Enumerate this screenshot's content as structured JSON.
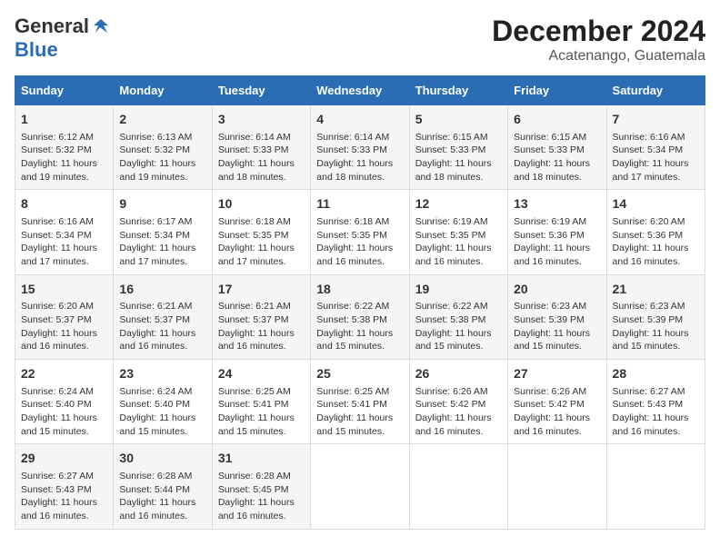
{
  "logo": {
    "general": "General",
    "blue": "Blue"
  },
  "title": "December 2024",
  "subtitle": "Acatenango, Guatemala",
  "headers": [
    "Sunday",
    "Monday",
    "Tuesday",
    "Wednesday",
    "Thursday",
    "Friday",
    "Saturday"
  ],
  "weeks": [
    [
      {
        "day": "1",
        "info": "Sunrise: 6:12 AM\nSunset: 5:32 PM\nDaylight: 11 hours\nand 19 minutes."
      },
      {
        "day": "2",
        "info": "Sunrise: 6:13 AM\nSunset: 5:32 PM\nDaylight: 11 hours\nand 19 minutes."
      },
      {
        "day": "3",
        "info": "Sunrise: 6:14 AM\nSunset: 5:33 PM\nDaylight: 11 hours\nand 18 minutes."
      },
      {
        "day": "4",
        "info": "Sunrise: 6:14 AM\nSunset: 5:33 PM\nDaylight: 11 hours\nand 18 minutes."
      },
      {
        "day": "5",
        "info": "Sunrise: 6:15 AM\nSunset: 5:33 PM\nDaylight: 11 hours\nand 18 minutes."
      },
      {
        "day": "6",
        "info": "Sunrise: 6:15 AM\nSunset: 5:33 PM\nDaylight: 11 hours\nand 18 minutes."
      },
      {
        "day": "7",
        "info": "Sunrise: 6:16 AM\nSunset: 5:34 PM\nDaylight: 11 hours\nand 17 minutes."
      }
    ],
    [
      {
        "day": "8",
        "info": "Sunrise: 6:16 AM\nSunset: 5:34 PM\nDaylight: 11 hours\nand 17 minutes."
      },
      {
        "day": "9",
        "info": "Sunrise: 6:17 AM\nSunset: 5:34 PM\nDaylight: 11 hours\nand 17 minutes."
      },
      {
        "day": "10",
        "info": "Sunrise: 6:18 AM\nSunset: 5:35 PM\nDaylight: 11 hours\nand 17 minutes."
      },
      {
        "day": "11",
        "info": "Sunrise: 6:18 AM\nSunset: 5:35 PM\nDaylight: 11 hours\nand 16 minutes."
      },
      {
        "day": "12",
        "info": "Sunrise: 6:19 AM\nSunset: 5:35 PM\nDaylight: 11 hours\nand 16 minutes."
      },
      {
        "day": "13",
        "info": "Sunrise: 6:19 AM\nSunset: 5:36 PM\nDaylight: 11 hours\nand 16 minutes."
      },
      {
        "day": "14",
        "info": "Sunrise: 6:20 AM\nSunset: 5:36 PM\nDaylight: 11 hours\nand 16 minutes."
      }
    ],
    [
      {
        "day": "15",
        "info": "Sunrise: 6:20 AM\nSunset: 5:37 PM\nDaylight: 11 hours\nand 16 minutes."
      },
      {
        "day": "16",
        "info": "Sunrise: 6:21 AM\nSunset: 5:37 PM\nDaylight: 11 hours\nand 16 minutes."
      },
      {
        "day": "17",
        "info": "Sunrise: 6:21 AM\nSunset: 5:37 PM\nDaylight: 11 hours\nand 16 minutes."
      },
      {
        "day": "18",
        "info": "Sunrise: 6:22 AM\nSunset: 5:38 PM\nDaylight: 11 hours\nand 15 minutes."
      },
      {
        "day": "19",
        "info": "Sunrise: 6:22 AM\nSunset: 5:38 PM\nDaylight: 11 hours\nand 15 minutes."
      },
      {
        "day": "20",
        "info": "Sunrise: 6:23 AM\nSunset: 5:39 PM\nDaylight: 11 hours\nand 15 minutes."
      },
      {
        "day": "21",
        "info": "Sunrise: 6:23 AM\nSunset: 5:39 PM\nDaylight: 11 hours\nand 15 minutes."
      }
    ],
    [
      {
        "day": "22",
        "info": "Sunrise: 6:24 AM\nSunset: 5:40 PM\nDaylight: 11 hours\nand 15 minutes."
      },
      {
        "day": "23",
        "info": "Sunrise: 6:24 AM\nSunset: 5:40 PM\nDaylight: 11 hours\nand 15 minutes."
      },
      {
        "day": "24",
        "info": "Sunrise: 6:25 AM\nSunset: 5:41 PM\nDaylight: 11 hours\nand 15 minutes."
      },
      {
        "day": "25",
        "info": "Sunrise: 6:25 AM\nSunset: 5:41 PM\nDaylight: 11 hours\nand 15 minutes."
      },
      {
        "day": "26",
        "info": "Sunrise: 6:26 AM\nSunset: 5:42 PM\nDaylight: 11 hours\nand 16 minutes."
      },
      {
        "day": "27",
        "info": "Sunrise: 6:26 AM\nSunset: 5:42 PM\nDaylight: 11 hours\nand 16 minutes."
      },
      {
        "day": "28",
        "info": "Sunrise: 6:27 AM\nSunset: 5:43 PM\nDaylight: 11 hours\nand 16 minutes."
      }
    ],
    [
      {
        "day": "29",
        "info": "Sunrise: 6:27 AM\nSunset: 5:43 PM\nDaylight: 11 hours\nand 16 minutes."
      },
      {
        "day": "30",
        "info": "Sunrise: 6:28 AM\nSunset: 5:44 PM\nDaylight: 11 hours\nand 16 minutes."
      },
      {
        "day": "31",
        "info": "Sunrise: 6:28 AM\nSunset: 5:45 PM\nDaylight: 11 hours\nand 16 minutes."
      },
      null,
      null,
      null,
      null
    ]
  ]
}
